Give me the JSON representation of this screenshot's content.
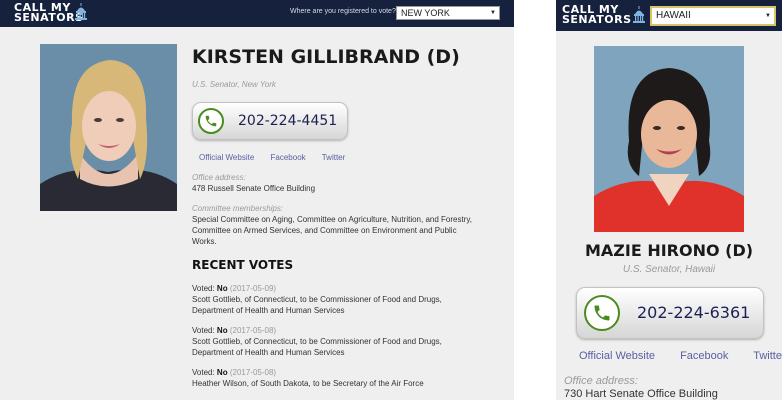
{
  "desktop": {
    "logo": {
      "line1": "CALL MY",
      "line2": "SENATORS"
    },
    "registered_label": "Where are you registered to vote?",
    "state": "NEW YORK",
    "senator": {
      "name": "KIRSTEN GILLIBRAND (D)",
      "role": "U.S. Senator, New York",
      "phone": "202-224-4451",
      "links": [
        "Official Website",
        "Facebook",
        "Twitter"
      ],
      "address_label": "Office address:",
      "address": "478 Russell Senate Office Building",
      "committee_label": "Committee memberships:",
      "committees": "Special Committee on Aging, Committee on Agriculture, Nutrition, and Forestry, Committee on Armed Services, and Committee on Environment and Public Works."
    },
    "recent_votes_title": "RECENT VOTES",
    "votes": [
      {
        "prefix": "Voted:",
        "vote": "No",
        "date": "(2017-05-09)",
        "desc": "Scott Gottlieb, of Connecticut, to be Commissioner of Food and Drugs, Department of Health and Human Services"
      },
      {
        "prefix": "Voted:",
        "vote": "No",
        "date": "(2017-05-08)",
        "desc": "Scott Gottlieb, of Connecticut, to be Commissioner of Food and Drugs, Department of Health and Human Services"
      },
      {
        "prefix": "Voted:",
        "vote": "No",
        "date": "(2017-05-08)",
        "desc": "Heather Wilson, of South Dakota, to be Secretary of the Air Force"
      }
    ]
  },
  "mobile": {
    "logo": {
      "line1": "CALL MY",
      "line2": "SENATORS"
    },
    "state": "HAWAII",
    "senator": {
      "name": "MAZIE HIRONO (D)",
      "role": "U.S. Senator, Hawaii",
      "phone": "202-224-6361",
      "links": [
        "Official Website",
        "Facebook",
        "Twitter"
      ],
      "address_label": "Office address:",
      "address": "730 Hart Senate Office Building"
    }
  }
}
